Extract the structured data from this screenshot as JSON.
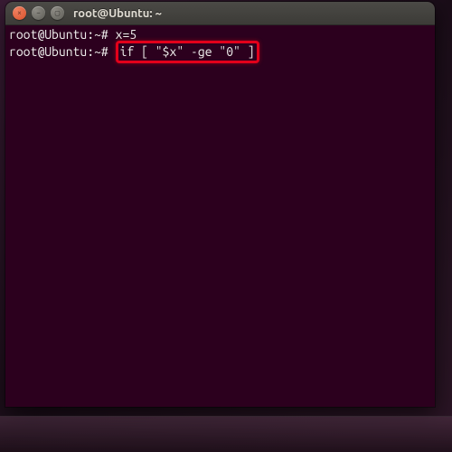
{
  "window": {
    "title": "root@Ubuntu: ~"
  },
  "terminal": {
    "prompt1": "root@Ubuntu:~# ",
    "cmd1": "x=5",
    "prompt2": "root@Ubuntu:~# ",
    "cmd2": "if [ \"$x\" -ge \"0\" ]"
  },
  "icons": {
    "close": "×",
    "minimize": "–",
    "maximize": "▢"
  }
}
